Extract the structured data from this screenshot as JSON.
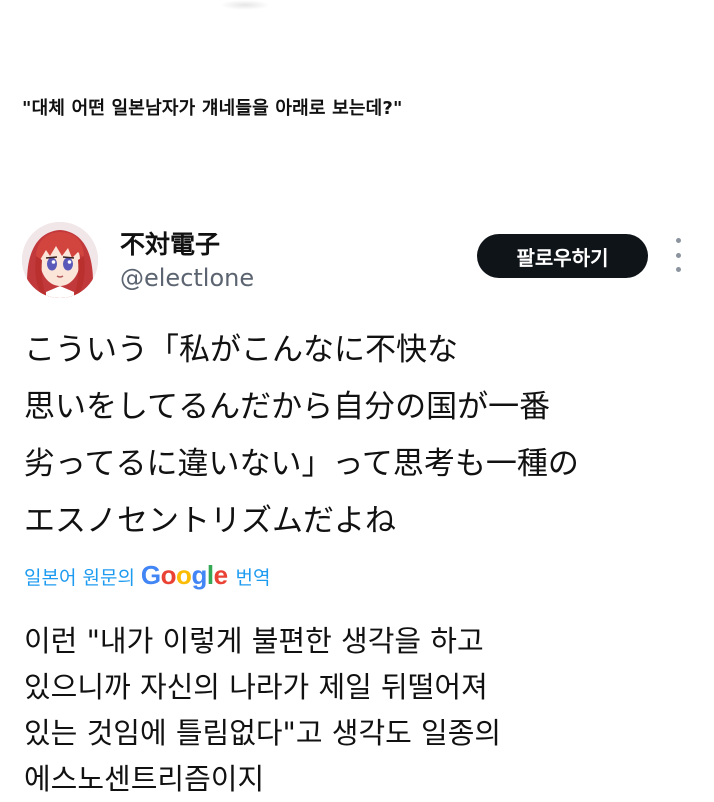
{
  "caption": "\"대체 어떤 일본남자가 걔네들을 아래로 보는데?\"",
  "tweet": {
    "display_name": "不対電子",
    "handle": "@electlone",
    "follow_label": "팔로우하기",
    "text_lines": [
      "こういう「私がこんなに不快な",
      "思いをしてるんだから自分の国が一番",
      "劣ってるに違いない」って思考も一種の",
      "エスノセントリズムだよね"
    ]
  },
  "translation": {
    "label_prefix": "일본어 원문의",
    "logo_letters": [
      "G",
      "o",
      "o",
      "g",
      "l",
      "e"
    ],
    "label_suffix": "번역",
    "lines": [
      "이런 \"내가 이렇게 불편한 생각을 하고",
      "있으니까 자신의 나라가 제일 뒤떨어져",
      "있는 것임에 틀림없다\"고 생각도 일종의",
      "에스노센트리즘이지"
    ]
  },
  "colors": {
    "link_blue": "#1d9bf0",
    "button_bg": "#0f1419",
    "handle_gray": "#5b6470"
  },
  "icons": {
    "avatar": "anime-girl-avatar",
    "more": "more-vertical-icon"
  }
}
